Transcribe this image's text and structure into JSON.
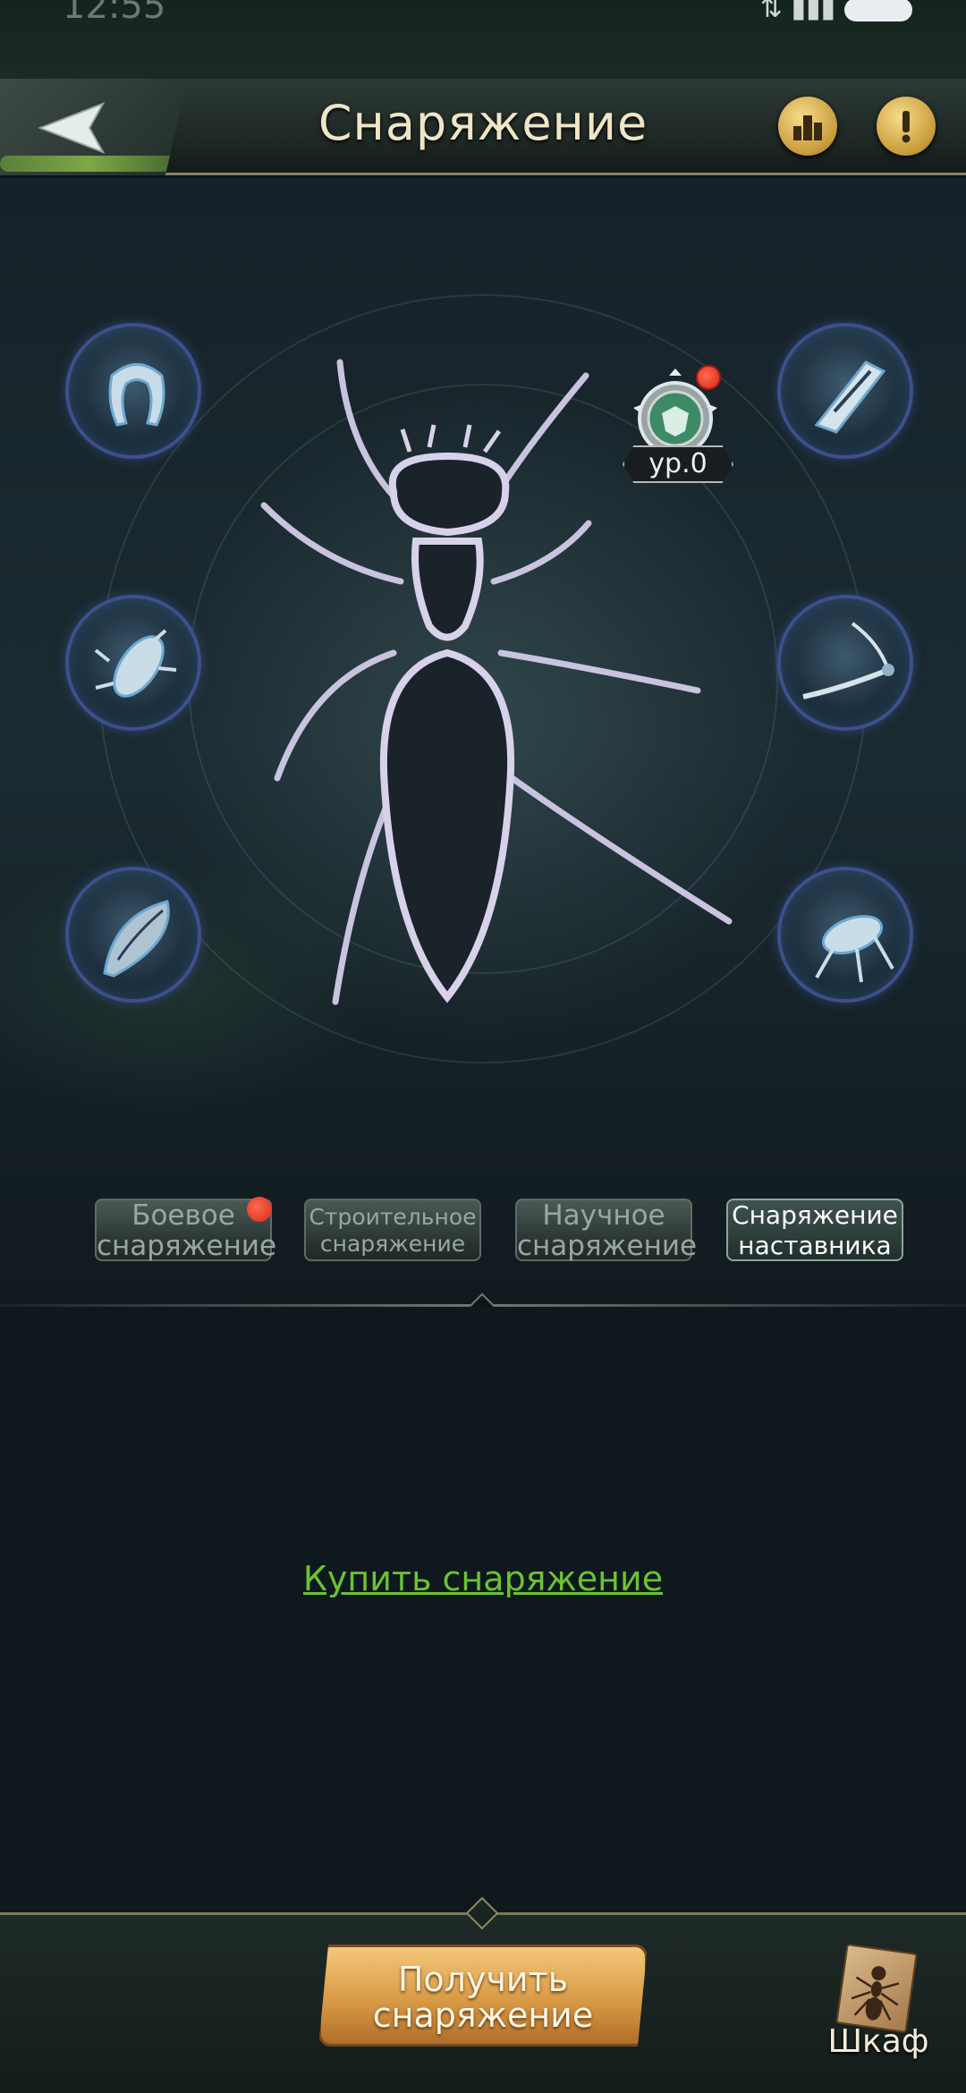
{
  "status_bar": {
    "time": "12:55"
  },
  "header": {
    "title": "Снаряжение",
    "back_icon": "back-arrow-icon",
    "rank_icon": "ranking-icon",
    "info_icon": "info-exclamation-icon"
  },
  "medal": {
    "level": "ур.0"
  },
  "equipment_slots": [
    {
      "icon": "mandible-gear-icon"
    },
    {
      "icon": "blade-gear-icon"
    },
    {
      "icon": "beetle-gear-icon"
    },
    {
      "icon": "antenna-gear-icon"
    },
    {
      "icon": "shell-gear-icon"
    },
    {
      "icon": "leg-gear-icon"
    }
  ],
  "tabs": [
    {
      "label": "Боевое снаряжение",
      "line1": "Боевое",
      "line2": "снаряжение"
    },
    {
      "label": "Строительное снаряжение",
      "line1": "Строительное",
      "line2": "снаряжение"
    },
    {
      "label": "Научное снаряжение",
      "line1": "Научное",
      "line2": "снаряжение"
    },
    {
      "label": "Снаряжение наставника",
      "line1": "Снаряжение",
      "line2": "наставника"
    }
  ],
  "panel": {
    "buy_link": "Купить снаряжение"
  },
  "bottom": {
    "get_button": {
      "line1": "Получить",
      "line2": "снаряжение"
    },
    "closet_label": "Шкаф"
  },
  "colors": {
    "accent_gold": "#d99a45",
    "link_green": "#6cc233",
    "slot_border": "#3e4f8e",
    "badge_red": "#d6271c"
  }
}
